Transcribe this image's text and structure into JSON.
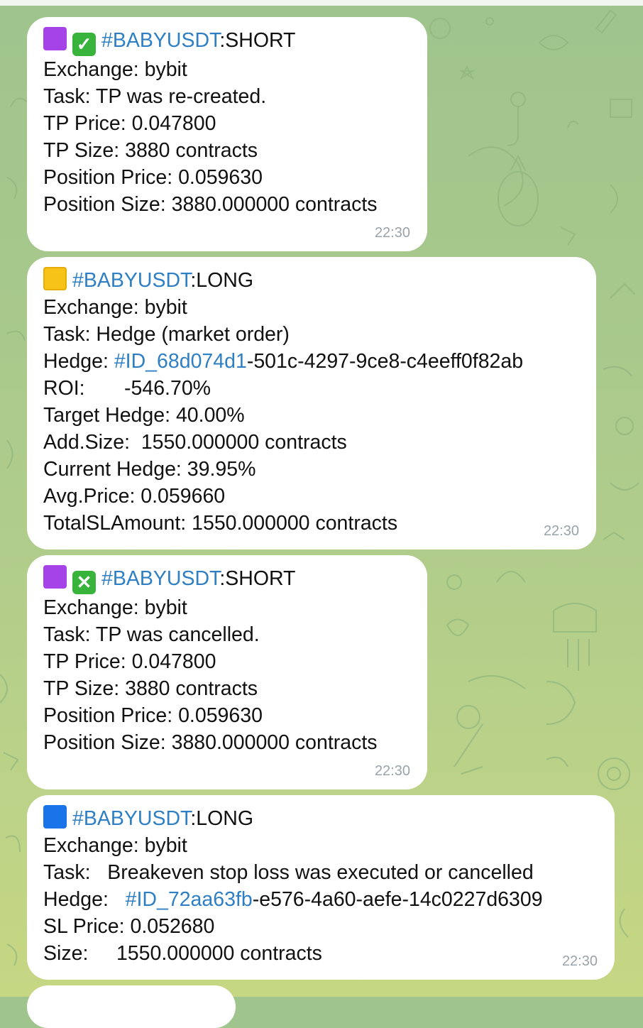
{
  "colors": {
    "link": "#2f7fc4",
    "bubble": "#ffffff",
    "time": "#9aa3a9",
    "background": "#a9c98c"
  },
  "messages": [
    {
      "icons": [
        "purple-square-icon",
        "check-mark-button-icon"
      ],
      "tag": "#BABYUSDT",
      "side": ":SHORT",
      "lines": [
        "Exchange: bybit",
        "Task: TP was re-created.",
        "TP Price: 0.047800",
        "TP Size: 3880 contracts",
        "Position Price: 0.059630",
        "Position Size: 3880.000000 contracts"
      ],
      "time": "22:30"
    },
    {
      "icons": [
        "yellow-square-icon"
      ],
      "tag": "#BABYUSDT",
      "side": ":LONG",
      "lines": [
        "Exchange: bybit",
        "Task: Hedge (market order)"
      ],
      "hedge_label": "Hedge: ",
      "hedge_link": "#ID_68d074d1",
      "hedge_rest": "-501c-4297-9ce8-c4eeff0f82ab",
      "lines_after": [
        "ROI:       -546.70%",
        "Target Hedge: 40.00%",
        "Add.Size:  1550.000000 contracts",
        "Current Hedge: 39.95%",
        "Avg.Price: 0.059660",
        "TotalSLAmount: 1550.000000 contracts"
      ],
      "time": "22:30"
    },
    {
      "icons": [
        "purple-square-icon",
        "cross-mark-button-icon"
      ],
      "tag": "#BABYUSDT",
      "side": ":SHORT",
      "lines": [
        "Exchange: bybit",
        "Task: TP was cancelled.",
        "TP Price: 0.047800",
        "TP Size: 3880 contracts",
        "Position Price: 0.059630",
        "Position Size: 3880.000000 contracts"
      ],
      "time": "22:30"
    },
    {
      "icons": [
        "blue-square-icon"
      ],
      "tag": "#BABYUSDT",
      "side": ":LONG",
      "lines": [
        "Exchange: bybit",
        "Task:   Breakeven stop loss was executed or cancelled"
      ],
      "hedge_label": "Hedge:   ",
      "hedge_link": "#ID_72aa63fb",
      "hedge_rest": "-e576-4a60-aefe-14c0227d6309",
      "lines_after": [
        "SL Price: 0.052680",
        "Size:     1550.000000 contracts"
      ],
      "time": "22:30"
    }
  ]
}
